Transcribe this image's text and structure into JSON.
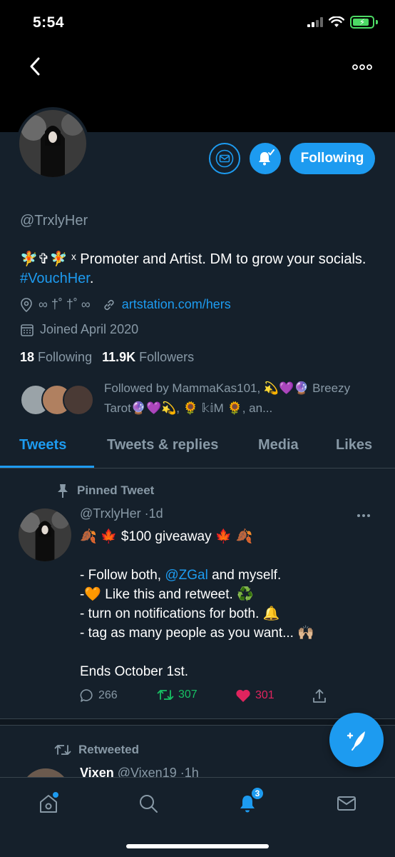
{
  "status_bar": {
    "time": "5:54"
  },
  "profile": {
    "handle": "@TrxlyHer",
    "bio_prefix": "🧚✞🧚 ˣ Promoter and Artist. DM to grow your socials. ",
    "bio_hashtag": "#VouchHer",
    "bio_suffix": ".",
    "location": "∞ †˚ †˚ ∞",
    "website": "artstation.com/hers",
    "joined": "Joined April 2020",
    "following_count": "18",
    "following_label": "Following",
    "followers_count": "11.9K",
    "followers_label": "Followers",
    "followed_by": "Followed by MammaKas101, 💫💜🔮 Breezy Tarot🔮💜💫, 🌻 𝕜𝕚Μ 🌻, an...",
    "follow_button": "Following"
  },
  "tabs": [
    {
      "label": "Tweets"
    },
    {
      "label": "Tweets & replies"
    },
    {
      "label": "Media"
    },
    {
      "label": "Likes"
    }
  ],
  "pinned_tweet": {
    "pinned_label": "Pinned Tweet",
    "author": "@TrxlyHer",
    "time": "·1d",
    "line1": "🍂 🍁  $100 giveaway 🍁 🍂",
    "line2_prefix": "- Follow both, ",
    "line2_mention": "@ZGal",
    "line2_suffix": " and myself.",
    "line3": "-🧡  Like this and retweet. ♻️",
    "line4": "- turn on notifications for both. 🔔",
    "line5": "- tag as many people as you want... 🙌🏼",
    "line6": "Ends October 1st.",
    "replies": "266",
    "retweets": "307",
    "likes": "301"
  },
  "retweet": {
    "label": "Retweeted",
    "name": "Vixen",
    "handle": "@Vixen19",
    "time": "·1h"
  },
  "nav": {
    "notifications_badge": "3"
  },
  "colors": {
    "background": "#15202b",
    "accent": "#1d9bf0",
    "muted": "#8899a6",
    "retweet_green": "#17bf63",
    "like_red": "#e0245e"
  }
}
